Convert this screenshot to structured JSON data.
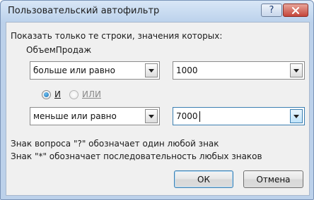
{
  "window": {
    "title": "Пользовательский автофильтр",
    "help_label": "?"
  },
  "dialog": {
    "prompt": "Показать только те строки, значения которых:",
    "field_name": "ОбъемПродаж",
    "condition1": {
      "operator": "больше или равно",
      "value": "1000"
    },
    "logic": {
      "and_label": "И",
      "or_label": "ИЛИ",
      "selected": "И"
    },
    "condition2": {
      "operator": "меньше или равно",
      "value": "7000"
    },
    "hint1": "Знак вопроса \"?\" обозначает один любой знак",
    "hint2": "Знак \"*\" обозначает последовательность любых знаков",
    "ok_label": "ОК",
    "cancel_label": "Отмена"
  },
  "icons": {
    "help": "help-icon",
    "close": "close-icon",
    "dropdown": "chevron-down-icon"
  }
}
